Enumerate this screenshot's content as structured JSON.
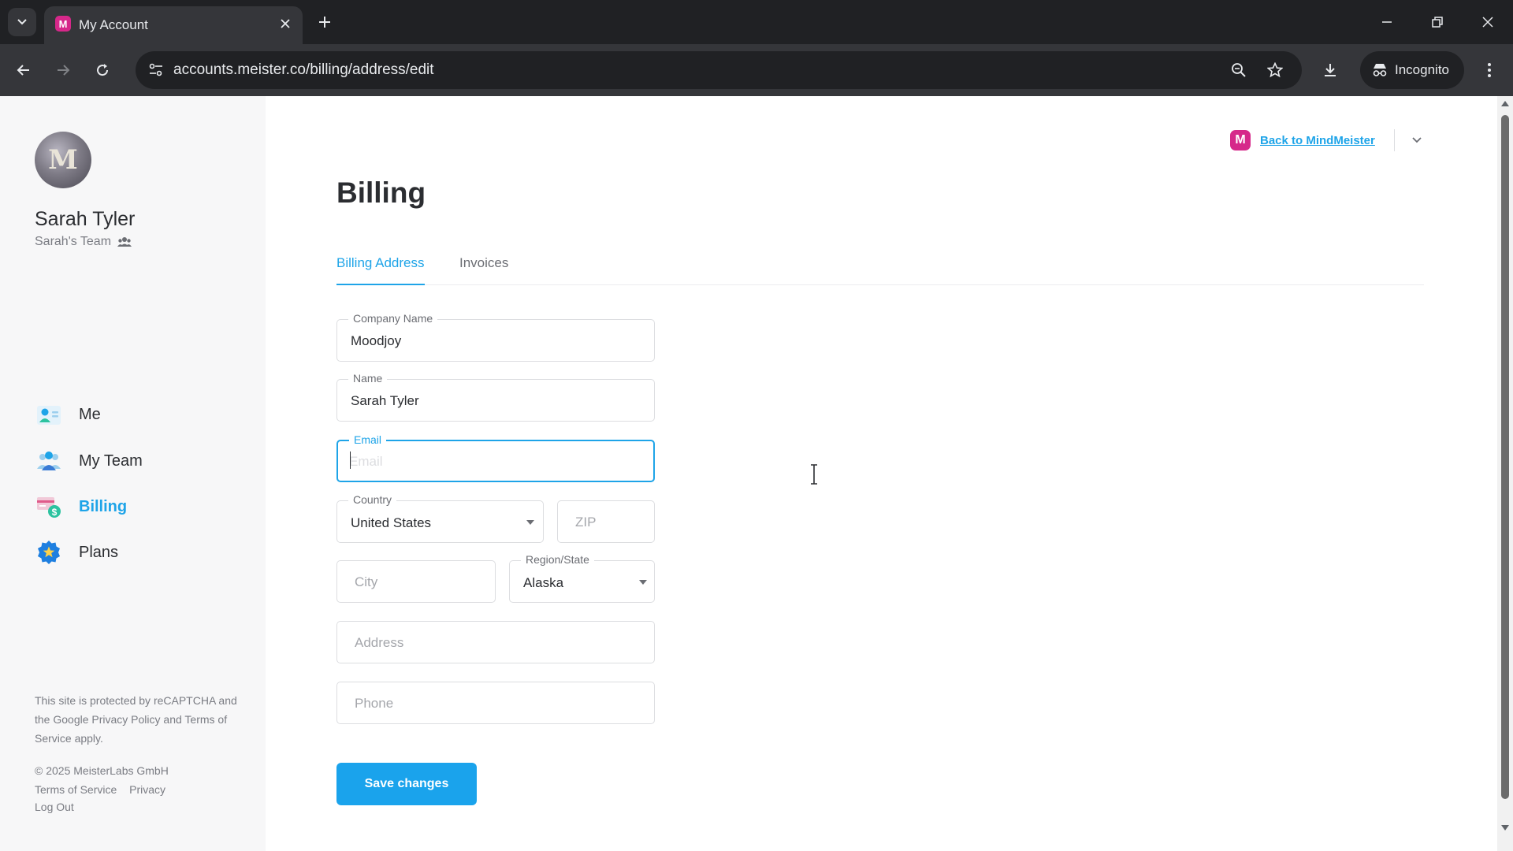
{
  "browser": {
    "tab_title": "My Account",
    "tab_favicon_letter": "M",
    "url": "accounts.meister.co/billing/address/edit",
    "incognito_label": "Incognito"
  },
  "sidebar": {
    "avatar_letter": "M",
    "user_name": "Sarah Tyler",
    "team_name": "Sarah's Team",
    "nav": [
      {
        "label": "Me",
        "icon": "person-card-icon",
        "active": false
      },
      {
        "label": "My Team",
        "icon": "team-icon",
        "active": false
      },
      {
        "label": "Billing",
        "icon": "billing-icon",
        "active": true
      },
      {
        "label": "Plans",
        "icon": "badge-star-icon",
        "active": false
      }
    ],
    "legal_text": "This site is protected by reCAPTCHA and the Google Privacy Policy and Terms of Service apply.",
    "copyright": "© 2025 MeisterLabs GmbH",
    "terms_link": "Terms of Service",
    "privacy_link": "Privacy",
    "logout_link": "Log Out"
  },
  "header": {
    "logo_letter": "M",
    "back_link": "Back to MindMeister"
  },
  "main": {
    "title": "Billing",
    "tabs": [
      {
        "label": "Billing Address",
        "active": true
      },
      {
        "label": "Invoices",
        "active": false
      }
    ]
  },
  "form": {
    "company": {
      "label": "Company Name",
      "value": "Moodjoy"
    },
    "name": {
      "label": "Name",
      "value": "Sarah Tyler"
    },
    "email": {
      "label": "Email",
      "value": "",
      "placeholder": "Email"
    },
    "country": {
      "label": "Country",
      "value": "United States"
    },
    "zip": {
      "placeholder": "ZIP"
    },
    "city": {
      "placeholder": "City"
    },
    "region": {
      "label": "Region/State",
      "value": "Alaska"
    },
    "address": {
      "placeholder": "Address"
    },
    "phone": {
      "placeholder": "Phone"
    },
    "save_label": "Save changes"
  },
  "colors": {
    "accent": "#1ea4e8",
    "brand_pink": "#d6288a",
    "sidebar_bg": "#f7f7f8",
    "chrome_dark": "#202124",
    "chrome_toolbar": "#35363a"
  }
}
